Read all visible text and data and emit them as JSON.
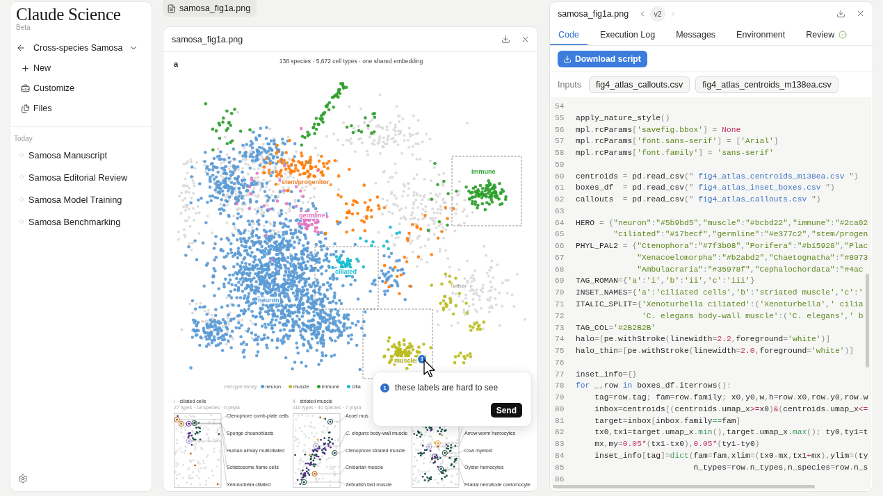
{
  "sidebar": {
    "brand": "Claude Science",
    "badge": "Beta",
    "project": "Cross-species Samosa",
    "nav": [
      {
        "kind": "new",
        "label": "New"
      },
      {
        "kind": "customize",
        "label": "Customize"
      },
      {
        "kind": "files",
        "label": "Files"
      }
    ],
    "section": "Today",
    "chats": [
      "Samosa Manuscript",
      "Samosa Editorial Review",
      "Samosa Model Training",
      "Samosa Benchmarking"
    ]
  },
  "open_file": {
    "label": "samosa_fig1a.png"
  },
  "viewer": {
    "title": "samosa_fig1a.png",
    "figure": {
      "panel": "a",
      "subtitle": "138 species · 5,672 cell types · one shared embedding",
      "cluster_labels": [
        {
          "kind": "family",
          "text": "immune",
          "color": "#2ca02c"
        },
        {
          "kind": "family",
          "text": "stem/progenitor",
          "color": "#e8802a"
        },
        {
          "kind": "family",
          "text": "germline",
          "color": "#e377c2"
        },
        {
          "kind": "family",
          "text": "ciliated",
          "color": "#17becf"
        },
        {
          "kind": "other",
          "text": "other",
          "color": "#a6a6a6"
        },
        {
          "kind": "family",
          "text": "neuron",
          "color": "#5b9bd5"
        },
        {
          "kind": "family",
          "text": "muscle",
          "color": "#a9aa1c"
        }
      ],
      "pin": "1",
      "legend": {
        "title": "cell-type family",
        "items": [
          {
            "label": "neuron",
            "color": "#5b9bd5"
          },
          {
            "label": "muscle",
            "color": "#bcbd22"
          },
          {
            "label": "immune",
            "color": "#2ca02c"
          },
          {
            "label": "cilia",
            "color": "#17becf"
          }
        ]
      },
      "insets": [
        {
          "tag": "i",
          "title": "ciliated cells",
          "stats": "27 types · 18 species · 6 phyla",
          "callouts": [
            "Ctenophore comb-plate cells",
            "Sponge choanoblasts",
            "Human airway multiciliated",
            "Schistosome flame cells",
            "*Xenoturbella* ciliated"
          ]
        },
        {
          "tag": "ii",
          "title": "striated muscle",
          "stats": "116 types · 40 species · 7 phyla",
          "callouts": [
            "Acoel mus",
            "*C. elegans* body-wall muscle",
            "Ctenophore striated muscle",
            "Cnidarian muscle",
            "Zebrafish fast muscle"
          ]
        },
        {
          "callouts": [
            "Arrow worm hemocytes",
            "Cow myeloid",
            "Oyster hemocytes",
            "Filarial nematode coelomocyte"
          ]
        }
      ]
    },
    "comment": {
      "number": "1",
      "value": "these labels are hard to see",
      "send": "Send"
    }
  },
  "detail": {
    "title": "samosa_fig1a.png",
    "version": {
      "label": "v2",
      "previous": {
        "disabled": false
      },
      "next": {
        "disabled": true
      }
    },
    "tabs": [
      {
        "label": "Code",
        "selected": true,
        "verified": false
      },
      {
        "label": "Execution Log",
        "selected": false,
        "verified": false
      },
      {
        "label": "Messages",
        "selected": false,
        "verified": false
      },
      {
        "label": "Environment",
        "selected": false,
        "verified": false
      },
      {
        "label": "Review",
        "selected": false,
        "verified": true
      }
    ],
    "download_button": "Download script",
    "inputs_label": "Inputs",
    "inputs": [
      "fig4_atlas_callouts.csv",
      "fig4_atlas_centroids_m138ea.csv"
    ],
    "code": [
      {
        "number": "54"
      },
      {
        "number": "55",
        "tokens": [
          {
            "kind": "name",
            "text": "apply_nature_style"
          },
          {
            "kind": "punct",
            "text": "()"
          }
        ]
      },
      {
        "number": "56",
        "tokens": [
          {
            "kind": "name",
            "text": "mpl"
          },
          {
            "kind": "punct",
            "text": "."
          },
          {
            "kind": "name",
            "text": "rcParams"
          },
          {
            "kind": "punct",
            "text": "["
          },
          {
            "kind": "string",
            "text": "'savefig.bbox'"
          },
          {
            "kind": "punct",
            "text": "] = "
          },
          {
            "kind": "number",
            "text": "None"
          }
        ]
      },
      {
        "number": "57",
        "tokens": [
          {
            "kind": "name",
            "text": "mpl"
          },
          {
            "kind": "punct",
            "text": "."
          },
          {
            "kind": "name",
            "text": "rcParams"
          },
          {
            "kind": "punct",
            "text": "["
          },
          {
            "kind": "string",
            "text": "'font.sans-serif'"
          },
          {
            "kind": "punct",
            "text": "] = ["
          },
          {
            "kind": "string",
            "text": "'Arial'"
          },
          {
            "kind": "punct",
            "text": "]"
          }
        ]
      },
      {
        "number": "58",
        "tokens": [
          {
            "kind": "name",
            "text": "mpl"
          },
          {
            "kind": "punct",
            "text": "."
          },
          {
            "kind": "name",
            "text": "rcParams"
          },
          {
            "kind": "punct",
            "text": "["
          },
          {
            "kind": "string",
            "text": "'font.family'"
          },
          {
            "kind": "punct",
            "text": "] = "
          },
          {
            "kind": "string",
            "text": "'sans-serif'"
          }
        ]
      },
      {
        "number": "59"
      },
      {
        "number": "60",
        "tokens": [
          {
            "kind": "name",
            "text": "centroids "
          },
          {
            "kind": "punct",
            "text": "= "
          },
          {
            "kind": "name",
            "text": "pd"
          },
          {
            "kind": "punct",
            "text": "."
          },
          {
            "kind": "name",
            "text": "read_csv"
          },
          {
            "kind": "punct",
            "text": "(\" "
          },
          {
            "kind": "path",
            "text": "fig4_atlas_centroids_m138ea.csv"
          },
          {
            "kind": "punct",
            "text": " \")"
          }
        ]
      },
      {
        "number": "61",
        "tokens": [
          {
            "kind": "name",
            "text": "boxes_df  "
          },
          {
            "kind": "punct",
            "text": "= "
          },
          {
            "kind": "name",
            "text": "pd"
          },
          {
            "kind": "punct",
            "text": "."
          },
          {
            "kind": "name",
            "text": "read_csv"
          },
          {
            "kind": "punct",
            "text": "(\" "
          },
          {
            "kind": "path",
            "text": "fig4_atlas_inset_boxes.csv"
          },
          {
            "kind": "punct",
            "text": " \")"
          }
        ]
      },
      {
        "number": "62",
        "tokens": [
          {
            "kind": "name",
            "text": "callouts  "
          },
          {
            "kind": "punct",
            "text": "= "
          },
          {
            "kind": "name",
            "text": "pd"
          },
          {
            "kind": "punct",
            "text": "."
          },
          {
            "kind": "name",
            "text": "read_csv"
          },
          {
            "kind": "punct",
            "text": "(\" "
          },
          {
            "kind": "path",
            "text": "fig4_atlas_callouts.csv"
          },
          {
            "kind": "punct",
            "text": " \")"
          }
        ]
      },
      {
        "number": "63"
      },
      {
        "number": "64",
        "tokens": [
          {
            "kind": "name",
            "text": "HERO "
          },
          {
            "kind": "punct",
            "text": "= {"
          },
          {
            "kind": "string",
            "text": "\"neuron\""
          },
          {
            "kind": "punct",
            "text": ":"
          },
          {
            "kind": "string",
            "text": "\"#5b9bd5\""
          },
          {
            "kind": "punct",
            "text": ","
          },
          {
            "kind": "string",
            "text": "\"muscle\""
          },
          {
            "kind": "punct",
            "text": ":"
          },
          {
            "kind": "string",
            "text": "\"#bcbd22\""
          },
          {
            "kind": "punct",
            "text": ","
          },
          {
            "kind": "string",
            "text": "\"immune\""
          },
          {
            "kind": "punct",
            "text": ":"
          },
          {
            "kind": "string",
            "text": "\"#2ca02"
          }
        ]
      },
      {
        "number": "65",
        "tokens": [
          {
            "kind": "string",
            "text": "        \"ciliated\""
          },
          {
            "kind": "punct",
            "text": ":"
          },
          {
            "kind": "string",
            "text": "\"#17becf\""
          },
          {
            "kind": "punct",
            "text": ","
          },
          {
            "kind": "string",
            "text": "\"germline\""
          },
          {
            "kind": "punct",
            "text": ":"
          },
          {
            "kind": "string",
            "text": "\"#e377c2\""
          },
          {
            "kind": "punct",
            "text": ","
          },
          {
            "kind": "string",
            "text": "\"stem/progen"
          }
        ]
      },
      {
        "number": "66",
        "tokens": [
          {
            "kind": "name",
            "text": "PHYL_PAL2 "
          },
          {
            "kind": "punct",
            "text": "= {"
          },
          {
            "kind": "string",
            "text": "\"Ctenophora\""
          },
          {
            "kind": "punct",
            "text": ":"
          },
          {
            "kind": "string",
            "text": "\"#7f3b08\""
          },
          {
            "kind": "punct",
            "text": ","
          },
          {
            "kind": "string",
            "text": "\"Porifera\""
          },
          {
            "kind": "punct",
            "text": ":"
          },
          {
            "kind": "string",
            "text": "\"#b15928\""
          },
          {
            "kind": "punct",
            "text": ","
          },
          {
            "kind": "string",
            "text": "\"Plac"
          }
        ]
      },
      {
        "number": "67",
        "tokens": [
          {
            "kind": "string",
            "text": "             \"Xenacoelomorpha\""
          },
          {
            "kind": "punct",
            "text": ":"
          },
          {
            "kind": "string",
            "text": "\"#b2abd2\""
          },
          {
            "kind": "punct",
            "text": ","
          },
          {
            "kind": "string",
            "text": "\"Chaetognatha\""
          },
          {
            "kind": "punct",
            "text": ":"
          },
          {
            "kind": "string",
            "text": "\"#8073"
          }
        ]
      },
      {
        "number": "68",
        "tokens": [
          {
            "kind": "string",
            "text": "             \"Ambulacraria\""
          },
          {
            "kind": "punct",
            "text": ":"
          },
          {
            "kind": "string",
            "text": "\"#35978f\""
          },
          {
            "kind": "punct",
            "text": ","
          },
          {
            "kind": "string",
            "text": "\"Cephalochordata\""
          },
          {
            "kind": "punct",
            "text": ":"
          },
          {
            "kind": "string",
            "text": "\"#4ac"
          }
        ]
      },
      {
        "number": "69",
        "tokens": [
          {
            "kind": "name",
            "text": "TAG_ROMAN"
          },
          {
            "kind": "punct",
            "text": "={"
          },
          {
            "kind": "string",
            "text": "'a'"
          },
          {
            "kind": "punct",
            "text": ":"
          },
          {
            "kind": "string",
            "text": "'i'"
          },
          {
            "kind": "punct",
            "text": ","
          },
          {
            "kind": "string",
            "text": "'b'"
          },
          {
            "kind": "punct",
            "text": ":"
          },
          {
            "kind": "string",
            "text": "'ii'"
          },
          {
            "kind": "punct",
            "text": ","
          },
          {
            "kind": "string",
            "text": "'c'"
          },
          {
            "kind": "punct",
            "text": ":"
          },
          {
            "kind": "string",
            "text": "'iii'"
          },
          {
            "kind": "punct",
            "text": "}"
          }
        ]
      },
      {
        "number": "70",
        "tokens": [
          {
            "kind": "name",
            "text": "INSET_NAMES"
          },
          {
            "kind": "punct",
            "text": "={"
          },
          {
            "kind": "string",
            "text": "'a'"
          },
          {
            "kind": "punct",
            "text": ":"
          },
          {
            "kind": "string",
            "text": "'ciliated cells'"
          },
          {
            "kind": "punct",
            "text": ","
          },
          {
            "kind": "string",
            "text": "'b'"
          },
          {
            "kind": "punct",
            "text": ":"
          },
          {
            "kind": "string",
            "text": "'striated muscle'"
          },
          {
            "kind": "punct",
            "text": ","
          },
          {
            "kind": "string",
            "text": "'c'"
          },
          {
            "kind": "punct",
            "text": ":"
          },
          {
            "kind": "string",
            "text": "'"
          }
        ]
      },
      {
        "number": "71",
        "tokens": [
          {
            "kind": "name",
            "text": "ITALIC_SPLIT"
          },
          {
            "kind": "punct",
            "text": "={"
          },
          {
            "kind": "string",
            "text": "'Xenoturbella ciliated'"
          },
          {
            "kind": "punct",
            "text": ":("
          },
          {
            "kind": "string",
            "text": "'Xenoturbella'"
          },
          {
            "kind": "punct",
            "text": ","
          },
          {
            "kind": "string",
            "text": "' cilia"
          }
        ]
      },
      {
        "number": "72",
        "tokens": [
          {
            "kind": "string",
            "text": "              'C. elegans body-wall muscle'"
          },
          {
            "kind": "punct",
            "text": ":("
          },
          {
            "kind": "string",
            "text": "'C. elegans'"
          },
          {
            "kind": "punct",
            "text": ","
          },
          {
            "kind": "string",
            "text": "' b"
          }
        ]
      },
      {
        "number": "73",
        "tokens": [
          {
            "kind": "name",
            "text": "TAG_COL"
          },
          {
            "kind": "punct",
            "text": "="
          },
          {
            "kind": "string",
            "text": "'#2B2B2B'"
          }
        ]
      },
      {
        "number": "74",
        "tokens": [
          {
            "kind": "name",
            "text": "halo"
          },
          {
            "kind": "punct",
            "text": "=["
          },
          {
            "kind": "name",
            "text": "pe"
          },
          {
            "kind": "punct",
            "text": "."
          },
          {
            "kind": "name",
            "text": "withStroke"
          },
          {
            "kind": "punct",
            "text": "("
          },
          {
            "kind": "name",
            "text": "linewidth"
          },
          {
            "kind": "punct",
            "text": "="
          },
          {
            "kind": "number",
            "text": "2.2"
          },
          {
            "kind": "punct",
            "text": ","
          },
          {
            "kind": "name",
            "text": "foreground"
          },
          {
            "kind": "punct",
            "text": "="
          },
          {
            "kind": "string",
            "text": "'white'"
          },
          {
            "kind": "punct",
            "text": ")]"
          }
        ]
      },
      {
        "number": "75",
        "tokens": [
          {
            "kind": "name",
            "text": "halo_thin"
          },
          {
            "kind": "punct",
            "text": "=["
          },
          {
            "kind": "name",
            "text": "pe"
          },
          {
            "kind": "punct",
            "text": "."
          },
          {
            "kind": "name",
            "text": "withStroke"
          },
          {
            "kind": "punct",
            "text": "("
          },
          {
            "kind": "name",
            "text": "linewidth"
          },
          {
            "kind": "punct",
            "text": "="
          },
          {
            "kind": "number",
            "text": "2.0"
          },
          {
            "kind": "punct",
            "text": ","
          },
          {
            "kind": "name",
            "text": "foreground"
          },
          {
            "kind": "punct",
            "text": "="
          },
          {
            "kind": "string",
            "text": "'white'"
          },
          {
            "kind": "punct",
            "text": ")]"
          }
        ]
      },
      {
        "number": "76"
      },
      {
        "number": "77",
        "tokens": [
          {
            "kind": "name",
            "text": "inset_info"
          },
          {
            "kind": "punct",
            "text": "={}"
          }
        ]
      },
      {
        "number": "78",
        "tokens": [
          {
            "kind": "keyword",
            "text": "for"
          },
          {
            "kind": "name",
            "text": " _"
          },
          {
            "kind": "punct",
            "text": ","
          },
          {
            "kind": "name",
            "text": "row "
          },
          {
            "kind": "keyword",
            "text": "in"
          },
          {
            "kind": "name",
            "text": " boxes_df"
          },
          {
            "kind": "punct",
            "text": "."
          },
          {
            "kind": "name",
            "text": "iterrows"
          },
          {
            "kind": "punct",
            "text": "():"
          }
        ]
      },
      {
        "number": "79",
        "tokens": [
          {
            "kind": "name",
            "text": "    tag"
          },
          {
            "kind": "punct",
            "text": "="
          },
          {
            "kind": "name",
            "text": "row"
          },
          {
            "kind": "punct",
            "text": "."
          },
          {
            "kind": "name",
            "text": "tag"
          },
          {
            "kind": "punct",
            "text": "; "
          },
          {
            "kind": "name",
            "text": "fam"
          },
          {
            "kind": "punct",
            "text": "="
          },
          {
            "kind": "name",
            "text": "row"
          },
          {
            "kind": "punct",
            "text": "."
          },
          {
            "kind": "name",
            "text": "family"
          },
          {
            "kind": "punct",
            "text": "; "
          },
          {
            "kind": "name",
            "text": "x0"
          },
          {
            "kind": "punct",
            "text": ","
          },
          {
            "kind": "name",
            "text": "y0"
          },
          {
            "kind": "punct",
            "text": ","
          },
          {
            "kind": "name",
            "text": "w"
          },
          {
            "kind": "punct",
            "text": ","
          },
          {
            "kind": "name",
            "text": "h"
          },
          {
            "kind": "punct",
            "text": "="
          },
          {
            "kind": "name",
            "text": "row"
          },
          {
            "kind": "punct",
            "text": "."
          },
          {
            "kind": "name",
            "text": "x0"
          },
          {
            "kind": "punct",
            "text": ","
          },
          {
            "kind": "name",
            "text": "row"
          },
          {
            "kind": "punct",
            "text": "."
          },
          {
            "kind": "name",
            "text": "y0"
          },
          {
            "kind": "punct",
            "text": ","
          },
          {
            "kind": "name",
            "text": "row"
          },
          {
            "kind": "punct",
            "text": "."
          },
          {
            "kind": "name",
            "text": "w"
          }
        ]
      },
      {
        "number": "80",
        "tokens": [
          {
            "kind": "name",
            "text": "    inbox"
          },
          {
            "kind": "punct",
            "text": "="
          },
          {
            "kind": "name",
            "text": "centroids"
          },
          {
            "kind": "punct",
            "text": "[("
          },
          {
            "kind": "name",
            "text": "centroids"
          },
          {
            "kind": "punct",
            "text": "."
          },
          {
            "kind": "name",
            "text": "umap_x"
          },
          {
            "kind": "number",
            "text": ">="
          },
          {
            "kind": "name",
            "text": "x0"
          },
          {
            "kind": "punct",
            "text": ")"
          },
          {
            "kind": "number",
            "text": "&"
          },
          {
            "kind": "punct",
            "text": "("
          },
          {
            "kind": "name",
            "text": "centroids"
          },
          {
            "kind": "punct",
            "text": "."
          },
          {
            "kind": "name",
            "text": "umap_x"
          },
          {
            "kind": "number",
            "text": "<="
          }
        ]
      },
      {
        "number": "81",
        "tokens": [
          {
            "kind": "name",
            "text": "    target"
          },
          {
            "kind": "punct",
            "text": "="
          },
          {
            "kind": "name",
            "text": "inbox"
          },
          {
            "kind": "punct",
            "text": "["
          },
          {
            "kind": "name",
            "text": "inbox"
          },
          {
            "kind": "punct",
            "text": "."
          },
          {
            "kind": "name",
            "text": "family"
          },
          {
            "kind": "call",
            "text": "=="
          },
          {
            "kind": "name",
            "text": "fam"
          },
          {
            "kind": "punct",
            "text": "]"
          }
        ]
      },
      {
        "number": "82",
        "tokens": [
          {
            "kind": "name",
            "text": "    tx0"
          },
          {
            "kind": "punct",
            "text": ","
          },
          {
            "kind": "name",
            "text": "tx1"
          },
          {
            "kind": "punct",
            "text": "="
          },
          {
            "kind": "name",
            "text": "target"
          },
          {
            "kind": "punct",
            "text": "."
          },
          {
            "kind": "name",
            "text": "umap_x"
          },
          {
            "kind": "punct",
            "text": "."
          },
          {
            "kind": "call",
            "text": "min"
          },
          {
            "kind": "punct",
            "text": "(),"
          },
          {
            "kind": "name",
            "text": "target"
          },
          {
            "kind": "punct",
            "text": "."
          },
          {
            "kind": "name",
            "text": "umap_x"
          },
          {
            "kind": "punct",
            "text": "."
          },
          {
            "kind": "call",
            "text": "max"
          },
          {
            "kind": "punct",
            "text": "(); "
          },
          {
            "kind": "name",
            "text": "ty0"
          },
          {
            "kind": "punct",
            "text": ","
          },
          {
            "kind": "name",
            "text": "ty1"
          },
          {
            "kind": "punct",
            "text": "="
          },
          {
            "kind": "name",
            "text": "t"
          }
        ]
      },
      {
        "number": "83",
        "tokens": [
          {
            "kind": "name",
            "text": "    mx"
          },
          {
            "kind": "punct",
            "text": ","
          },
          {
            "kind": "name",
            "text": "my"
          },
          {
            "kind": "punct",
            "text": "="
          },
          {
            "kind": "number",
            "text": "0.05*"
          },
          {
            "kind": "punct",
            "text": "("
          },
          {
            "kind": "name",
            "text": "tx1"
          },
          {
            "kind": "number",
            "text": "-"
          },
          {
            "kind": "name",
            "text": "tx0"
          },
          {
            "kind": "punct",
            "text": "),"
          },
          {
            "kind": "number",
            "text": "0.05*"
          },
          {
            "kind": "punct",
            "text": "("
          },
          {
            "kind": "name",
            "text": "ty1"
          },
          {
            "kind": "number",
            "text": "-"
          },
          {
            "kind": "name",
            "text": "ty0"
          },
          {
            "kind": "punct",
            "text": ")"
          }
        ]
      },
      {
        "number": "84",
        "tokens": [
          {
            "kind": "name",
            "text": "    inset_info"
          },
          {
            "kind": "punct",
            "text": "["
          },
          {
            "kind": "name",
            "text": "tag"
          },
          {
            "kind": "punct",
            "text": "]="
          },
          {
            "kind": "call",
            "text": "dict"
          },
          {
            "kind": "punct",
            "text": "("
          },
          {
            "kind": "name",
            "text": "fam"
          },
          {
            "kind": "punct",
            "text": "="
          },
          {
            "kind": "name",
            "text": "fam"
          },
          {
            "kind": "punct",
            "text": ","
          },
          {
            "kind": "name",
            "text": "xlim"
          },
          {
            "kind": "punct",
            "text": "=("
          },
          {
            "kind": "name",
            "text": "tx0"
          },
          {
            "kind": "number",
            "text": "-"
          },
          {
            "kind": "name",
            "text": "mx"
          },
          {
            "kind": "punct",
            "text": ","
          },
          {
            "kind": "name",
            "text": "tx1"
          },
          {
            "kind": "number",
            "text": "+"
          },
          {
            "kind": "name",
            "text": "mx"
          },
          {
            "kind": "punct",
            "text": "),"
          },
          {
            "kind": "name",
            "text": "ylim"
          },
          {
            "kind": "punct",
            "text": "=("
          },
          {
            "kind": "name",
            "text": "ty"
          }
        ]
      },
      {
        "number": "85",
        "tokens": [
          {
            "kind": "name",
            "text": "                         n_types"
          },
          {
            "kind": "punct",
            "text": "="
          },
          {
            "kind": "name",
            "text": "row"
          },
          {
            "kind": "punct",
            "text": "."
          },
          {
            "kind": "name",
            "text": "n_types"
          },
          {
            "kind": "punct",
            "text": ","
          },
          {
            "kind": "name",
            "text": "n_species"
          },
          {
            "kind": "punct",
            "text": "="
          },
          {
            "kind": "name",
            "text": "row"
          },
          {
            "kind": "punct",
            "text": "."
          },
          {
            "kind": "name",
            "text": "n_s"
          }
        ]
      },
      {
        "number": "86"
      }
    ]
  }
}
